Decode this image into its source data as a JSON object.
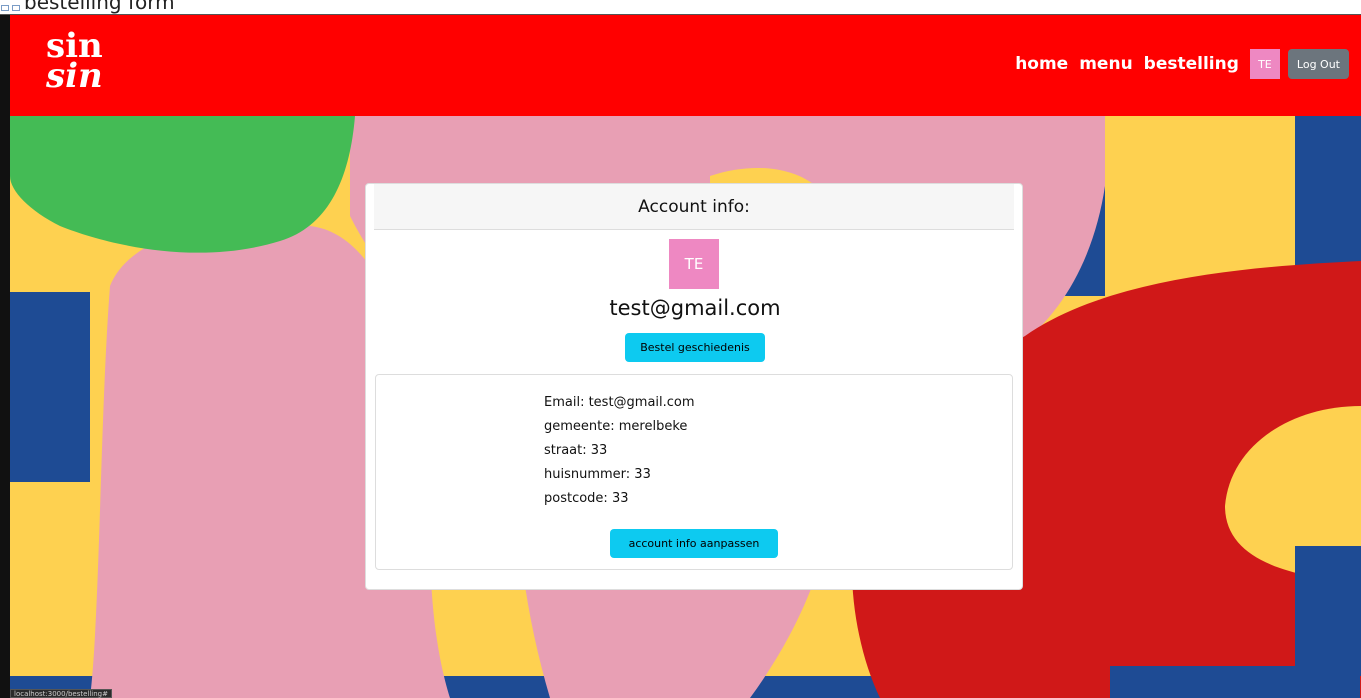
{
  "window": {
    "tab_title": "bestelling form"
  },
  "navbar": {
    "logo_line1": "sin",
    "logo_line2": "sin",
    "links": [
      "home",
      "menu",
      "bestelling"
    ],
    "avatar_initials": "TE",
    "logout_label": "Log Out",
    "background_color": "#ff0000"
  },
  "account": {
    "header": "Account info:",
    "avatar_initials": "TE",
    "email_heading": "test@gmail.com",
    "history_button": "Bestel geschiedenis",
    "details": {
      "email": "Email: test@gmail.com",
      "gemeente": "gemeente: merelbeke",
      "straat": "straat: 33",
      "huisnummer": "huisnummer: 33",
      "postcode": "postcode: 33"
    },
    "edit_button": "account info aanpassen"
  },
  "status_bar": {
    "url": "localhost:3000/bestelling#"
  },
  "colors": {
    "accent_cyan": "#0dcaf0",
    "avatar_pink": "#ee88c2",
    "bg_pink": "#e89fb4",
    "bg_green": "#44bb55",
    "bg_blue": "#1e4b94",
    "bg_yellow": "#fed150",
    "bg_red": "#d01818"
  }
}
